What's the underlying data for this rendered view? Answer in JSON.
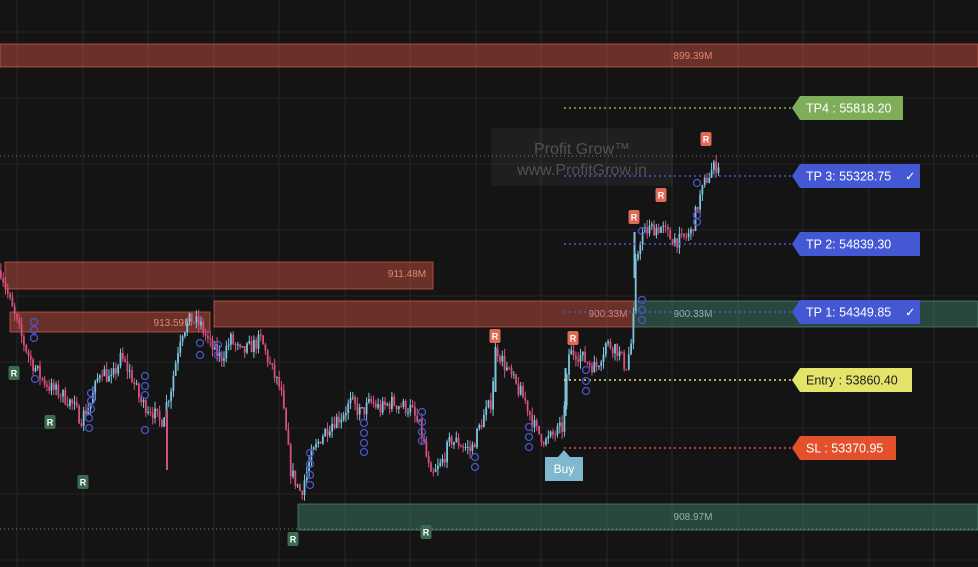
{
  "watermark": {
    "line1": "Profit Grow™",
    "line2": "www.ProfitGrow.in"
  },
  "colors": {
    "background": "#141414",
    "up_candle": "#7ec3de",
    "down_candle": "#d6507a",
    "supply_zone": "#e05a4a",
    "demand_zone": "#4a8e77",
    "tp4": "#7eae5a",
    "tp": "#4558d4",
    "entry": "#e4e36a",
    "sl": "#e2502c",
    "r_marker_top": "#e06a55",
    "r_marker_bottom": "#3d6b50",
    "pivot_circle": "#4a55c8",
    "buy": "#7fb8cf"
  },
  "levels": [
    {
      "id": "tp4",
      "label": "TP4 : 55818.20",
      "check": false,
      "color": "#7eae5a",
      "text_color": "#ffffff",
      "line_style": "dotted"
    },
    {
      "id": "tp3",
      "label": "TP 3: 55328.75",
      "check": true,
      "color": "#4558d4",
      "text_color": "#ffffff",
      "line_style": "dotted"
    },
    {
      "id": "tp2",
      "label": "TP 2: 54839.30",
      "check": false,
      "color": "#4558d4",
      "text_color": "#ffffff",
      "line_style": "dotted"
    },
    {
      "id": "tp1",
      "label": "TP 1: 54349.85",
      "check": true,
      "color": "#4558d4",
      "text_color": "#ffffff",
      "line_style": "dotted"
    },
    {
      "id": "entry",
      "label": "Entry : 53860.40",
      "check": false,
      "color": "#e4e36a",
      "text_color": "#1a1a1a",
      "line_style": "dotted"
    },
    {
      "id": "sl",
      "label": "SL : 53370.95",
      "check": false,
      "color": "#e2502c",
      "text_color": "#ffffff",
      "line_style": "dotted"
    }
  ],
  "check_mark": "✓",
  "zones": [
    {
      "type": "supply",
      "label": "899.39M"
    },
    {
      "type": "supply",
      "label": "911.48M"
    },
    {
      "type": "supply",
      "label": "913.59M"
    },
    {
      "type": "supply",
      "label": "900.33M"
    },
    {
      "type": "demand",
      "label": "900.33M"
    },
    {
      "type": "demand",
      "label": "908.97M"
    }
  ],
  "markers": {
    "r_label": "R",
    "buy_label": "Buy"
  },
  "chart_data": {
    "type": "candlestick",
    "title": "",
    "xlabel": "",
    "ylabel": "",
    "ylim": [
      52900,
      56250
    ],
    "grid": true,
    "trade_levels": {
      "tp4": 55818.2,
      "tp3": 55328.75,
      "tp2": 54839.3,
      "tp1": 54349.85,
      "entry": 53860.4,
      "sl": 53370.95
    },
    "close_path": [
      [
        0,
        54650
      ],
      [
        10,
        54400
      ],
      [
        20,
        54180
      ],
      [
        30,
        54000
      ],
      [
        40,
        53880
      ],
      [
        50,
        53800
      ],
      [
        60,
        53760
      ],
      [
        70,
        53700
      ],
      [
        80,
        53580
      ],
      [
        90,
        53700
      ],
      [
        100,
        53950
      ],
      [
        110,
        53850
      ],
      [
        120,
        54020
      ],
      [
        130,
        53900
      ],
      [
        140,
        53700
      ],
      [
        150,
        53650
      ],
      [
        160,
        53550
      ],
      [
        170,
        53800
      ],
      [
        180,
        54200
      ],
      [
        190,
        54300
      ],
      [
        200,
        54250
      ],
      [
        210,
        54100
      ],
      [
        220,
        54020
      ],
      [
        230,
        54150
      ],
      [
        240,
        54050
      ],
      [
        250,
        54100
      ],
      [
        260,
        54150
      ],
      [
        270,
        53950
      ],
      [
        280,
        53780
      ],
      [
        290,
        53200
      ],
      [
        300,
        53050
      ],
      [
        310,
        53300
      ],
      [
        320,
        53450
      ],
      [
        330,
        53550
      ],
      [
        340,
        53600
      ],
      [
        350,
        53700
      ],
      [
        360,
        53620
      ],
      [
        370,
        53700
      ],
      [
        380,
        53650
      ],
      [
        390,
        53700
      ],
      [
        400,
        53680
      ],
      [
        410,
        53650
      ],
      [
        420,
        53500
      ],
      [
        430,
        53150
      ],
      [
        440,
        53250
      ],
      [
        450,
        53430
      ],
      [
        460,
        53400
      ],
      [
        470,
        53350
      ],
      [
        480,
        53550
      ],
      [
        490,
        53700
      ],
      [
        495,
        54100
      ],
      [
        505,
        53950
      ],
      [
        515,
        53820
      ],
      [
        525,
        53700
      ],
      [
        535,
        53500
      ],
      [
        545,
        53420
      ],
      [
        555,
        53480
      ],
      [
        562,
        53520
      ],
      [
        568,
        54050
      ],
      [
        575,
        54060
      ],
      [
        585,
        54000
      ],
      [
        595,
        53950
      ],
      [
        605,
        54120
      ],
      [
        615,
        54100
      ],
      [
        625,
        53950
      ],
      [
        632,
        54180
      ],
      [
        634,
        54650
      ],
      [
        640,
        54900
      ],
      [
        650,
        54950
      ],
      [
        660,
        54960
      ],
      [
        670,
        54880
      ],
      [
        680,
        54860
      ],
      [
        690,
        54920
      ],
      [
        698,
        55150
      ],
      [
        705,
        55300
      ],
      [
        712,
        55380
      ],
      [
        718,
        55420
      ]
    ]
  }
}
